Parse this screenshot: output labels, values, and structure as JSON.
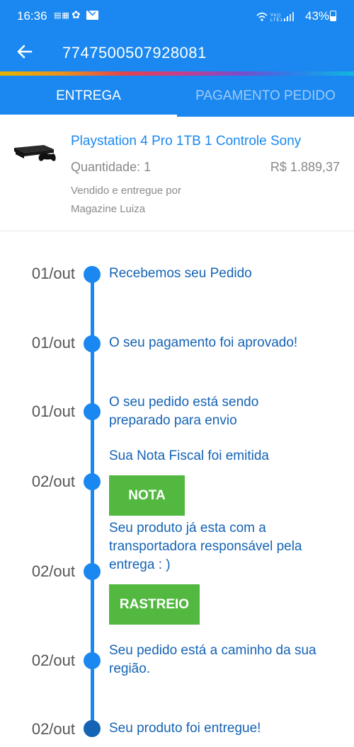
{
  "status_bar": {
    "time": "16:36",
    "battery": "43%"
  },
  "app_bar": {
    "order_number": "7747500507928081"
  },
  "tabs": [
    {
      "label": "ENTREGA",
      "active": true
    },
    {
      "label": "PAGAMENTO PEDIDO",
      "active": false
    }
  ],
  "product": {
    "title": "Playstation 4 Pro 1TB 1 Controle Sony",
    "quantity": "Quantidade: 1",
    "price": "R$ 1.889,37",
    "sold_by_label": "Vendido e entregue por",
    "seller": "Magazine Luiza"
  },
  "timeline": [
    {
      "date": "01/out",
      "text": "Recebemos seu Pedido"
    },
    {
      "date": "01/out",
      "text": "O seu pagamento foi aprovado!"
    },
    {
      "date": "01/out",
      "text": "O seu pedido está sendo preparado para envio"
    },
    {
      "date": "02/out",
      "text": "Sua Nota Fiscal foi emitida",
      "button": "NOTA"
    },
    {
      "date": "02/out",
      "text": "Seu produto já esta com a transportadora responsável pela entrega : )",
      "button": "RASTREIO"
    },
    {
      "date": "02/out",
      "text": "Seu pedido está a caminho da sua região."
    },
    {
      "date": "02/out",
      "text": "Seu produto foi entregue!"
    }
  ],
  "colors": {
    "primary": "#1a88f0",
    "timeline_text": "#1563b4",
    "button_green": "#52b840"
  }
}
